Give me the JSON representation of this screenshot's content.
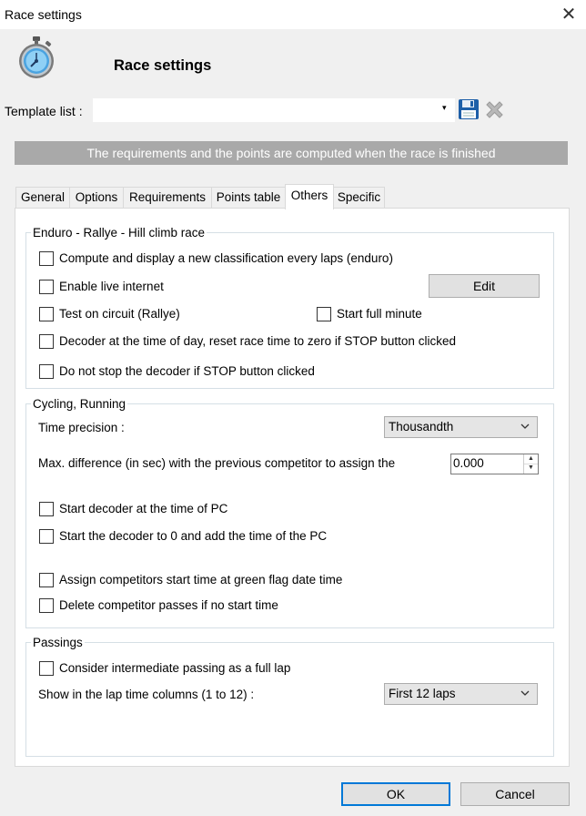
{
  "window": {
    "title": "Race settings",
    "close_glyph": "✕"
  },
  "header": {
    "title": "Race settings",
    "icon": "stopwatch-icon"
  },
  "template": {
    "label": "Template list :",
    "value": "",
    "dropdown_glyph": "▾",
    "save_icon": "floppy-disk-icon",
    "delete_icon": "delete-x-icon"
  },
  "banner": {
    "text": "The requirements and the points are computed when the race is finished"
  },
  "tabs": [
    {
      "label": "General",
      "active": false
    },
    {
      "label": "Options",
      "active": false
    },
    {
      "label": "Requirements",
      "active": false
    },
    {
      "label": "Points table",
      "active": false
    },
    {
      "label": "Others",
      "active": true
    },
    {
      "label": "Specific",
      "active": false
    }
  ],
  "enduro": {
    "title": "Enduro - Rallye - Hill climb race",
    "compute_label": "Compute and display a new classification every laps (enduro)",
    "compute_checked": false,
    "live_label": "Enable live internet",
    "live_checked": false,
    "edit_label": "Edit",
    "circuit_label": "Test on circuit (Rallye)",
    "circuit_checked": false,
    "fullminute_label": "Start full minute",
    "fullminute_checked": false,
    "decoder_tod_label": "Decoder at the time of day, reset race time to zero if STOP button clicked",
    "decoder_tod_checked": false,
    "nostop_label": "Do not stop the decoder if STOP button clicked",
    "nostop_checked": false
  },
  "cycling": {
    "title": "Cycling, Running",
    "precision_label": "Time precision :",
    "precision_value": "Thousandth",
    "maxdiff_label": "Max. difference (in sec) with the previous competitor to assign the",
    "maxdiff_value": "0.000",
    "startpc_label": "Start decoder at the time of PC",
    "startpc_checked": false,
    "startzero_label": "Start the decoder to 0 and add the time of the PC",
    "startzero_checked": false,
    "greenflag_label": "Assign competitors start time at green flag date time",
    "greenflag_checked": false,
    "deletepasses_label": "Delete competitor passes if no start time",
    "deletepasses_checked": false
  },
  "passings": {
    "title": "Passings",
    "intermediate_label": "Consider intermediate passing as a full lap",
    "intermediate_checked": false,
    "laptime_label": "Show in the lap time columns (1 to 12) :",
    "laptime_value": "First 12 laps"
  },
  "footer": {
    "ok_label": "OK",
    "cancel_label": "Cancel"
  }
}
